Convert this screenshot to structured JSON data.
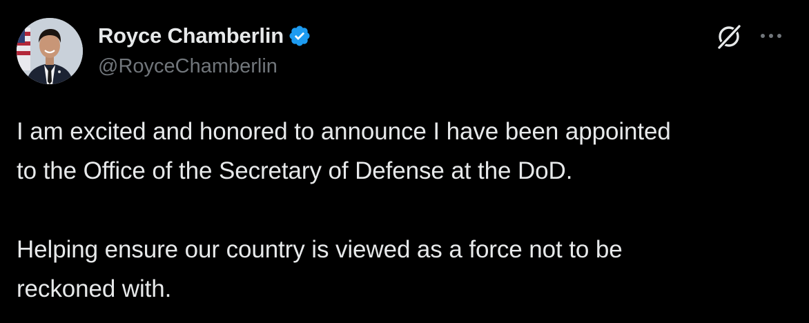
{
  "author": {
    "display_name": "Royce Chamberlin",
    "handle": "@RoyceChamberlin",
    "verified": true,
    "verified_color": "#1d9bf0"
  },
  "actions": {
    "grok_icon": "grok-icon",
    "more_icon": "more-horizontal-icon"
  },
  "post": {
    "paragraph_1_line_1": "I am excited and honored to announce I have been appointed",
    "paragraph_1_line_2": "to the Office of the Secretary of Defense at the DoD.",
    "paragraph_2_line_1": "Helping ensure our country is viewed as a force not to be",
    "paragraph_2_line_2": "reckoned with."
  },
  "colors": {
    "background": "#000000",
    "primary_text": "#e7e9ea",
    "secondary_text": "#71767b"
  }
}
